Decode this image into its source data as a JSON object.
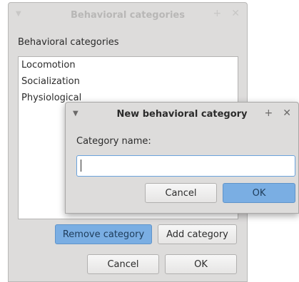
{
  "back_window": {
    "title": "Behavioral categories",
    "menu_icon": "chevron-down-icon",
    "pin_icon": "plus-icon",
    "close_icon": "close-icon",
    "section_label": "Behavioral categories",
    "categories": [
      "Locomotion",
      "Socialization",
      "Physiological"
    ],
    "remove_button": "Remove category",
    "add_button": "Add category",
    "cancel_button": "Cancel",
    "ok_button": "OK"
  },
  "dialog": {
    "title": "New behavioral category",
    "field_label": "Category name:",
    "field_value": "",
    "cancel_button": "Cancel",
    "ok_button": "OK"
  },
  "colors": {
    "window_bg": "#dddcdb",
    "accent": "#7aaee3",
    "focus_border": "#6aa2dc"
  }
}
